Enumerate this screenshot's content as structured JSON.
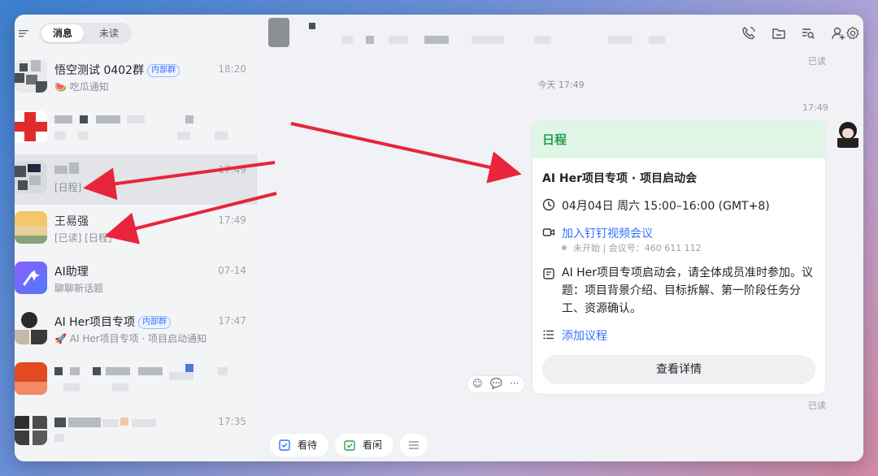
{
  "tabs": {
    "messages": "消息",
    "unread": "未读"
  },
  "conversations": [
    {
      "title": "悟空测试 0402群",
      "badge": "内部群",
      "time": "18:20",
      "subtitle": "🍉 吃瓜通知"
    },
    {
      "title": "",
      "time": "",
      "subtitle": ""
    },
    {
      "title": "",
      "time": "17:49",
      "subtitle": "[日程]"
    },
    {
      "title": "王易强",
      "time": "17:49",
      "subtitle": "[已读] [日程]"
    },
    {
      "title": "AI助理",
      "time": "07-14",
      "subtitle": "聊聊新话题"
    },
    {
      "title": "AI Her项目专项",
      "badge": "内部群",
      "time": "17:47",
      "subtitle": "🚀 AI Her项目专项 · 项目启动通知"
    },
    {
      "title": "",
      "time": "",
      "subtitle": ""
    },
    {
      "title": "",
      "time": "17:35",
      "subtitle": ""
    }
  ],
  "chat": {
    "read_top": "已读",
    "day_separator": "今天 17:49",
    "msg_time": "17:49",
    "read_bottom": "已读"
  },
  "card": {
    "header": "日程",
    "title": "AI Her项目专项 · 项目启动会",
    "datetime": "04月04日 周六 15:00–16:00 (GMT+8)",
    "meeting_link": "加入钉钉视频会议",
    "meeting_meta": "未开始 | 会议号：460 611 112",
    "description": "AI Her项目专项启动会，请全体成员准时参加。议题：项目背景介绍、目标拆解、第一阶段任务分工、资源确认。",
    "add_agenda": "添加议程",
    "detail_button": "查看详情"
  },
  "quick_actions": {
    "watch": "看待",
    "idle": "看闲"
  },
  "colors": {
    "accent_green": "#2a9e4f",
    "card_header_bg": "#dff6e7",
    "link_blue": "#3370ff",
    "arrow_red": "#e8253a"
  },
  "icons": {
    "header": [
      "phone-icon",
      "folder-icon",
      "search-doc-icon",
      "add-user-icon",
      "settings-icon"
    ],
    "card": [
      "clock-icon",
      "video-icon",
      "note-icon",
      "list-icon"
    ]
  }
}
